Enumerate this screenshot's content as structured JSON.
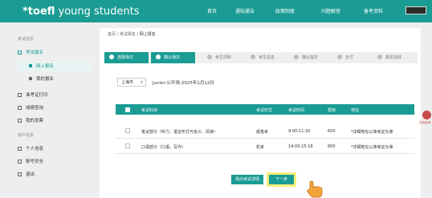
{
  "header": {
    "logo_prefix": "*toefl",
    "logo_suffix": " young students",
    "nav": [
      "首页",
      "通知通告",
      "政策制度",
      "问题解答",
      "备考资料"
    ]
  },
  "sidebar": {
    "section1": "考试信息",
    "exam_register": "考试报名",
    "sub_online": "网上报名",
    "sub_mine": "我的报名",
    "ticket_print": "准考证打印",
    "score_query": "成绩查询",
    "my_fees": "我的发票",
    "section2": "用户信息",
    "personal_info": "个人信息",
    "account_security": "账号安全",
    "logout": "退出"
  },
  "breadcrumb": {
    "home": "首页",
    "sep1": "/",
    "exam_reg": "考试报名",
    "sep2": "/",
    "current": "网上报名"
  },
  "steps": [
    "选择场次",
    "确认场次",
    "考生须知",
    "考生信息",
    "确认提交",
    "支付",
    "报名完成"
  ],
  "filter": {
    "city": "上海市",
    "session": "Junior-公开场-2025年1月12日"
  },
  "table": {
    "headers": [
      "考试科目",
      "考试形式",
      "考试时间",
      "费用",
      "地址"
    ],
    "rows": [
      {
        "subject": "笔试部分（听力、语言形式与含义、阅读）",
        "form": "纸笔考",
        "time": "9:00-11:20",
        "fee": "600",
        "address": "*详细地址以准考证为准"
      },
      {
        "subject": "口语部分（口语、写作）",
        "form": "机考",
        "time": "14:00-15:18",
        "fee": "600",
        "address": "*详细地址以准考证为准"
      }
    ]
  },
  "buttons": {
    "detail": "场次考试详情",
    "next": "下一步"
  },
  "float": {
    "label": "在线咨询"
  },
  "colors": {
    "brand": "#1a9c94",
    "highlight": "#f5f07a"
  }
}
